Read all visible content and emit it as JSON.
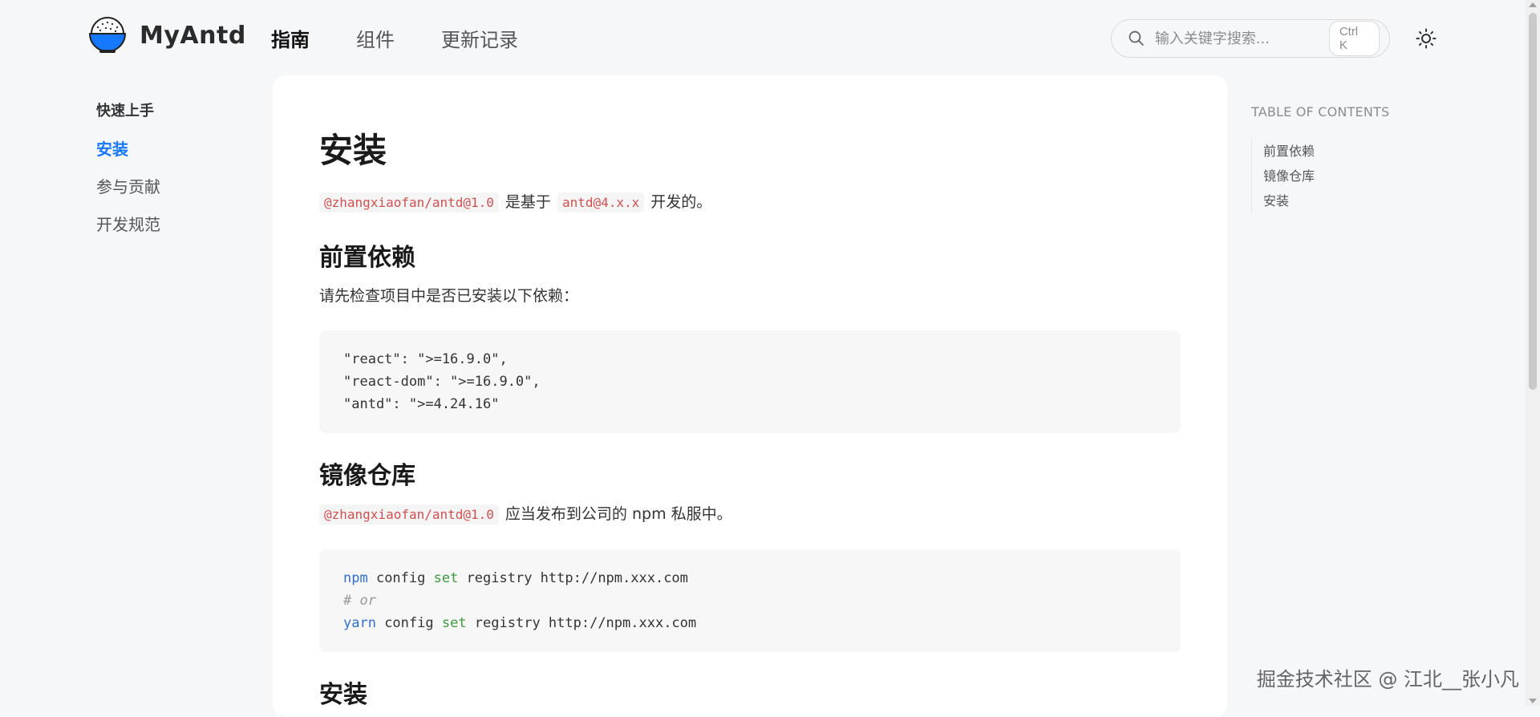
{
  "header": {
    "logo_text": "MyAntd",
    "nav": [
      {
        "label": "指南",
        "active": true
      },
      {
        "label": "组件",
        "active": false
      },
      {
        "label": "更新记录",
        "active": false
      }
    ],
    "search": {
      "placeholder": "输入关键字搜索...",
      "shortcut": "Ctrl K"
    },
    "theme_icon": "sun-icon"
  },
  "sidebar": {
    "group_title": "快速上手",
    "items": [
      {
        "label": "安装",
        "active": true
      },
      {
        "label": "参与贡献",
        "active": false
      },
      {
        "label": "开发规范",
        "active": false
      }
    ]
  },
  "main": {
    "title": "安装",
    "intro": {
      "code1": "@zhangxiaofan/antd@1.0",
      "text1": "是基于",
      "code2": "antd@4.x.x",
      "text2": "开发的。"
    },
    "sections": [
      {
        "heading": "前置依赖",
        "desc": "请先检查项目中是否已安装以下依赖：",
        "code_lines": [
          "\"react\": \">=16.9.0\",",
          "\"react-dom\": \">=16.9.0\",",
          "\"antd\": \">=4.24.16\""
        ]
      },
      {
        "heading": "镜像仓库",
        "desc_code": "@zhangxiaofan/antd@1.0",
        "desc_text": "应当发布到公司的 npm 私服中。",
        "code": {
          "line1_cmd": "npm",
          "line1_mid": " config ",
          "line1_kw": "set",
          "line1_rest": " registry http://npm.xxx.com",
          "line2_comment": "# or",
          "line3_cmd": "yarn",
          "line3_mid": " config ",
          "line3_kw": "set",
          "line3_rest": " registry http://npm.xxx.com"
        }
      },
      {
        "heading": "安装"
      }
    ]
  },
  "toc": {
    "title": "TABLE OF CONTENTS",
    "items": [
      "前置依赖",
      "镜像仓库",
      "安装"
    ]
  },
  "watermark": "掘金技术社区 @ 江北__张小凡",
  "colors": {
    "accent": "#1677ff",
    "inline_code": "#d4504f",
    "background": "#f6f7f9"
  }
}
